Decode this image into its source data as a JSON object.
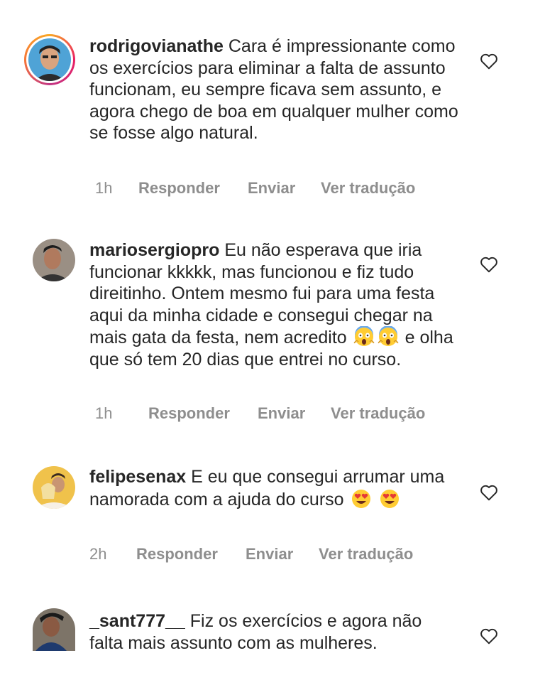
{
  "comments": [
    {
      "username": "rodrigovianathe",
      "text": "Cara é impressionante como os exercícios para eliminar a falta de assunto funcionam, eu sempre ficava sem assunto, e agora chego de boa em qualquer mulher como se fosse algo natural.",
      "time": "1h",
      "actions": [
        "Responder",
        "Enviar",
        "Ver tradução"
      ],
      "has_story_ring": true
    },
    {
      "username": "mariosergiopro",
      "text_before": "Eu não esperava que iria funcionar kkkkk, mas funcionou e fiz tudo direitinho. Ontem mesmo fui para uma festa aqui da minha cidade e consegui chegar na mais gata da festa, nem acredito",
      "emojis": [
        "face-screaming-in-fear",
        "face-screaming-in-fear"
      ],
      "text_after": "e olha que só tem 20 dias que entrei no curso.",
      "time": "1h",
      "actions": [
        "Responder",
        "Enviar",
        "Ver tradução"
      ]
    },
    {
      "username": "felipesenax",
      "text": "E eu que consegui arrumar uma namorada com a ajuda do curso",
      "emojis": [
        "smiling-face-with-heart-eyes",
        "smiling-face-with-heart-eyes"
      ],
      "time": "2h",
      "actions": [
        "Responder",
        "Enviar",
        "Ver tradução"
      ]
    },
    {
      "username": "_sant777__",
      "text": "Fiz os exercícios e agora não falta mais assunto com as mulheres."
    }
  ],
  "icons": {
    "like": "heart-outline-icon"
  },
  "colors": {
    "text": "#262626",
    "meta": "#8e8e8e",
    "ring_start": "#f9a825",
    "ring_end": "#c13584"
  }
}
